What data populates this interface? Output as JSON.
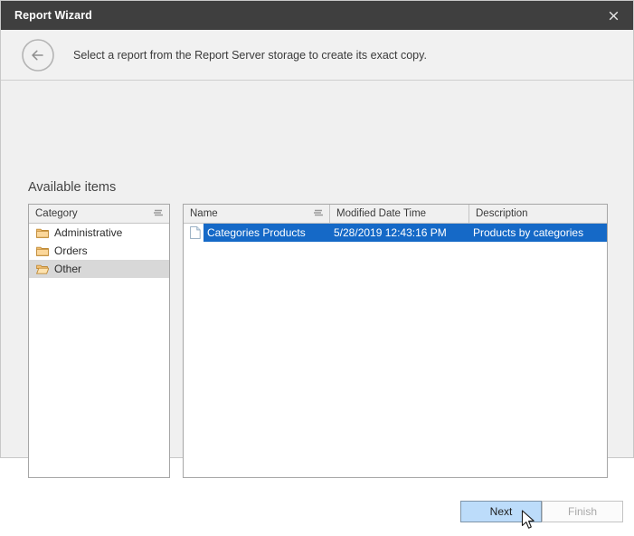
{
  "window": {
    "title": "Report Wizard",
    "close_icon": "close-icon"
  },
  "header": {
    "back_icon": "back-arrow-icon",
    "instruction": "Select a report from the Report Server storage to create its exact copy."
  },
  "main": {
    "section_label": "Available items",
    "category_panel": {
      "header": "Category",
      "sort_icon": "sort-indicator-icon",
      "items": [
        {
          "label": "Administrative",
          "icon": "folder-closed-icon",
          "selected": false
        },
        {
          "label": "Orders",
          "icon": "folder-closed-icon",
          "selected": false
        },
        {
          "label": "Other",
          "icon": "folder-open-icon",
          "selected": true
        }
      ]
    },
    "items_panel": {
      "columns": [
        {
          "label": "Name",
          "sort_icon": "sort-indicator-icon"
        },
        {
          "label": "Modified Date Time",
          "sort_icon": ""
        },
        {
          "label": "Description",
          "sort_icon": ""
        }
      ],
      "rows": [
        {
          "icon": "document-icon",
          "name": "Categories Products",
          "modified": "5/28/2019 12:43:16 PM",
          "description": "Products by categories",
          "selected": true
        }
      ]
    }
  },
  "footer": {
    "next_label": "Next",
    "finish_label": "Finish"
  },
  "colors": {
    "titlebar": "#3f3f3f",
    "selection_blue": "#1569c7",
    "button_hover": "#bcdcfa",
    "panel_bg": "#f0f0f0"
  },
  "cursor": {
    "icon": "arrow-cursor"
  }
}
